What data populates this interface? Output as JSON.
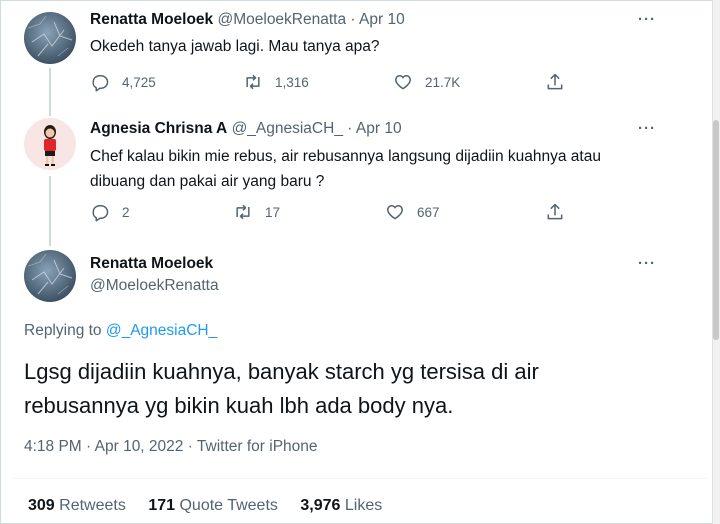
{
  "tweet1": {
    "name": "Renatta Moeloek",
    "handle": "@MoeloekRenatta",
    "separator": "·",
    "date": "Apr 10",
    "text": "Okedeh tanya jawab lagi. Mau tanya apa?",
    "replies": "4,725",
    "retweets": "1,316",
    "likes": "21.7K"
  },
  "tweet2": {
    "name": "Agnesia Chrisna A",
    "handle": "@_AgnesiaCH_",
    "separator": "·",
    "date": "Apr 10",
    "text_line1": "Chef kalau bikin mie rebus, air rebusannya langsung dijadiin kuahnya atau",
    "text_line2": "dibuang dan pakai air yang baru ?",
    "replies": "2",
    "retweets": "17",
    "likes": "667"
  },
  "main_tweet": {
    "name": "Renatta Moeloek",
    "handle": "@MoeloekRenatta",
    "replying_prefix": "Replying to",
    "replying_handle": "@_AgnesiaCH_",
    "text_line1": "Lgsg dijadiin kuahnya, banyak starch yg tersisa di air",
    "text_line2": "rebusannya yg bikin kuah lbh ada body nya.",
    "timestamp": "4:18 PM · Apr 10, 2022 · Twitter for iPhone",
    "retweets_count": "309",
    "retweets_label": "Retweets",
    "quotes_count": "171",
    "quotes_label": "Quote Tweets",
    "likes_count": "3,976",
    "likes_label": "Likes"
  },
  "more_label": "···",
  "icons": [
    "reply-icon",
    "retweet-icon",
    "like-icon",
    "share-icon",
    "more-icon"
  ],
  "colors": {
    "link": "#1d9bf0",
    "secondary": "#536471",
    "text": "#0f1419",
    "thread_line": "#cfd9de"
  }
}
